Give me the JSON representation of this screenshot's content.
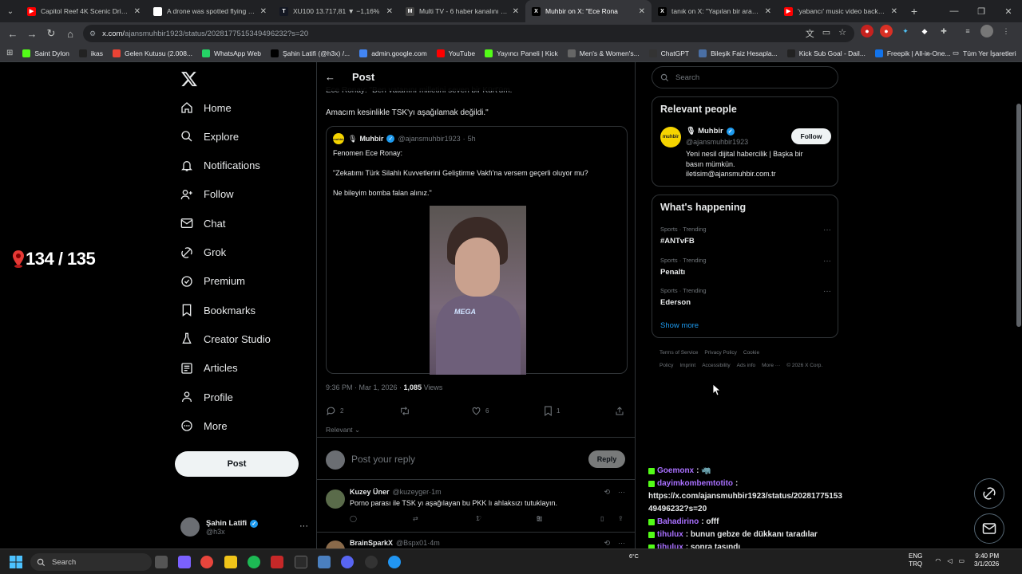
{
  "browser": {
    "tabs": [
      {
        "title": "Capitol Reef 4K Scenic Drive | U",
        "fav_color": "#ff0000",
        "fav_glyph": "▶"
      },
      {
        "title": "A drone was spotted flying in th",
        "fav_color": "#ffffff",
        "fav_glyph": "b"
      },
      {
        "title": "XU100 13.717,81 ▼ −1,16%",
        "fav_color": "#131722",
        "fav_glyph": "T"
      },
      {
        "title": "Multi TV - 6 haber kanalını ayn",
        "fav_color": "#444444",
        "fav_glyph": "M"
      },
      {
        "title": "Muhbir on X: \"Ece Rona",
        "fav_color": "#000000",
        "fav_glyph": "X",
        "active": true
      },
      {
        "title": "tanık on X: \"Yapılan bir araştırm",
        "fav_color": "#000000",
        "fav_glyph": "X"
      },
      {
        "title": "'yabancı' music video backstag",
        "fav_color": "#ff0000",
        "fav_glyph": "▶"
      }
    ],
    "url_host": "x.com/",
    "url_path": "ajansmuhbir1923/status/2028177515349496232?s=20",
    "bookmarks": [
      {
        "label": "Saint Dylon",
        "color": "#53fc18"
      },
      {
        "label": "ikas",
        "color": "#222222"
      },
      {
        "label": "Gelen Kutusu (2.008...",
        "color": "#ea4335"
      },
      {
        "label": "WhatsApp Web",
        "color": "#25d366"
      },
      {
        "label": "Şahin Latifi (@h3x) /...",
        "color": "#000000"
      },
      {
        "label": "admin.google.com",
        "color": "#4285f4"
      },
      {
        "label": "YouTube",
        "color": "#ff0000"
      },
      {
        "label": "Yayıncı Paneli | Kick",
        "color": "#53fc18"
      },
      {
        "label": "Men's & Women's...",
        "color": "#666666"
      },
      {
        "label": "ChatGPT",
        "color": "#333333"
      },
      {
        "label": "Bileşik Faiz Hesapla...",
        "color": "#4a6fa5"
      },
      {
        "label": "Kick Sub Goal - Dail...",
        "color": "#222222"
      },
      {
        "label": "Freepik | All-in-One...",
        "color": "#1273eb"
      }
    ],
    "bookmarks_all": "Tüm Yer İşaretleri"
  },
  "overlay": {
    "counter": "134 / 135"
  },
  "nav": {
    "items": [
      {
        "label": "Home",
        "icon": "home-icon"
      },
      {
        "label": "Explore",
        "icon": "search-icon"
      },
      {
        "label": "Notifications",
        "icon": "bell-icon"
      },
      {
        "label": "Follow",
        "icon": "person-plus-icon"
      },
      {
        "label": "Chat",
        "icon": "mail-icon"
      },
      {
        "label": "Grok",
        "icon": "grok-icon"
      },
      {
        "label": "Premium",
        "icon": "verified-icon"
      },
      {
        "label": "Bookmarks",
        "icon": "bookmark-icon"
      },
      {
        "label": "Creator Studio",
        "icon": "flask-icon"
      },
      {
        "label": "Articles",
        "icon": "article-icon"
      },
      {
        "label": "Profile",
        "icon": "person-icon"
      },
      {
        "label": "More",
        "icon": "more-circle-icon"
      }
    ],
    "post_button": "Post",
    "account_name": "Şahin Latifi",
    "account_handle": "@h3x"
  },
  "post": {
    "header": "Post",
    "text_partial": "Ece Ronay: \"Ben vatanını milletini seven bir Kürt'üm.",
    "text_line": "Amacım kesinlikle TSK'yı aşağılamak değildi.\"",
    "quote": {
      "author": "Muhbir",
      "handle": "@ajansmuhbir1923",
      "time": "5h",
      "line1": "Fenomen Ece Ronay:",
      "line2": "\"Zekatımı Türk Silahlı Kuvvetlerini Geliştirme Vakfı'na versem geçerli oluyor mu?",
      "line3": "Ne bileyim bomba falan alınız.\"",
      "media_logo": "MEGA"
    },
    "timestamp": "9:36 PM · Mar 1, 2026 · ",
    "views_count": "1,085",
    "views_label": " Views",
    "replies": "2",
    "reposts": "",
    "likes": "6",
    "bookmarks": "1",
    "sort": "Relevant",
    "reply_placeholder": "Post your reply",
    "reply_button": "Reply"
  },
  "replies": [
    {
      "name": "Kuzey Üner",
      "handle": "@kuzeyger",
      "time": "1m",
      "text": "Porno parası ile TSK yı aşağılayan bu PKK lı ahlaksızı tutuklayın.",
      "replies": "",
      "reposts": "",
      "likes": "1",
      "views": "9",
      "avatar_color": "#5a6b4a"
    },
    {
      "name": "BrainSparkX",
      "handle": "@Bspx01",
      "time": "4m",
      "text": "",
      "avatar_color": "#8a6a4a"
    }
  ],
  "sidebar": {
    "search_placeholder": "Search",
    "relevant_title": "Relevant people",
    "rp_name": "Muhbir",
    "rp_handle": "@ajansmuhbir1923",
    "rp_bio": "Yeni nesil dijital habercilik | Başka bir basın mümkün. iletisim@ajansmuhbir.com.tr",
    "follow": "Follow",
    "whats_happening": "What's happening",
    "trends": [
      {
        "category": "Sports · Trending",
        "name": "#ANTvFB"
      },
      {
        "category": "Sports · Trending",
        "name": "Penaltı"
      },
      {
        "category": "Sports · Trending",
        "name": "Ederson"
      }
    ],
    "show_more": "Show more",
    "footer": [
      "Terms of Service",
      "Privacy Policy",
      "Cookie Policy",
      "Imprint",
      "Accessibility",
      "Ads info",
      "More ···",
      "© 2026 X Corp."
    ]
  },
  "chat": [
    {
      "user": "Goemonx",
      "msg": ": 🦏"
    },
    {
      "user": "dayimkombemtotito",
      "msg": ":"
    },
    {
      "user": "",
      "msg": "https://x.com/ajansmuhbir1923/status/20281775153"
    },
    {
      "user": "",
      "msg": "49496232?s=20"
    },
    {
      "user": "Bahadirino",
      "msg": ": offf"
    },
    {
      "user": "tihulux",
      "msg": ": bunun gebze de dükkanı taradılar"
    },
    {
      "user": "tihulux",
      "msg": ": sonra taşındı"
    }
  ],
  "taskbar": {
    "search": "Search",
    "weather": "6°C",
    "lang1": "ENG",
    "lang2": "TRQ",
    "time": "9:40 PM",
    "date": "3/1/2026"
  }
}
